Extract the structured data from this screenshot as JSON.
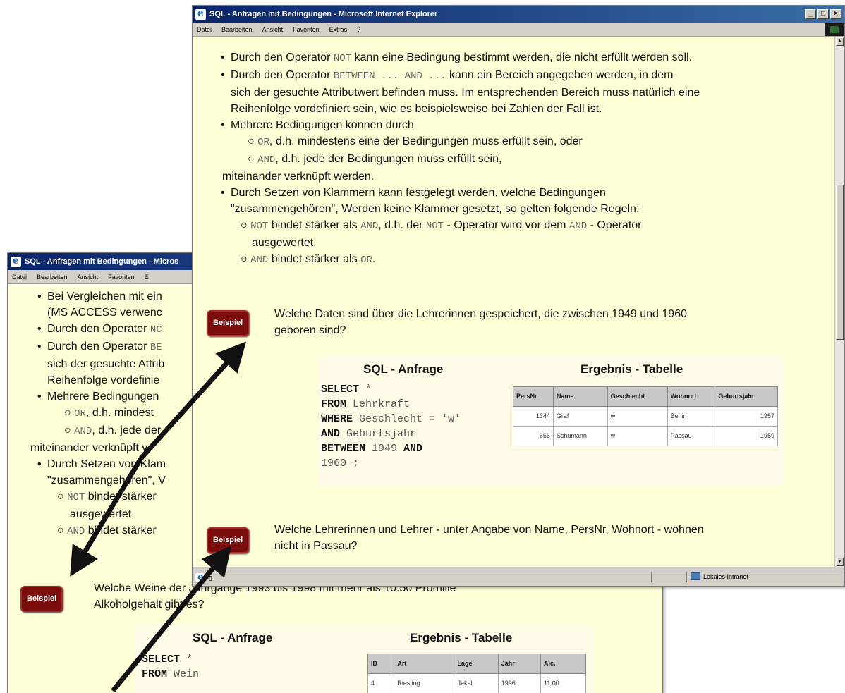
{
  "back_window": {
    "title": "SQL - Anfragen mit Bedingungen - Micros",
    "menu": [
      "Datei",
      "Bearbeiten",
      "Ansicht",
      "Favoriten",
      "E"
    ],
    "bullets": [
      {
        "text": "Bei Vergleichen mit ein",
        "cont": "(MS ACCESS verwenc"
      },
      {
        "pre": "Durch den Operator ",
        "mono": "NC"
      },
      {
        "pre": "Durch den Operator ",
        "mono": "BE",
        "cont1": "sich der gesuchte Attrib",
        "cont2": "Reihenfolge vordefinie"
      },
      {
        "text": "Mehrere Bedingungen"
      }
    ],
    "sub_or": {
      "mono": "OR",
      "text": ", d.h. mindest"
    },
    "sub_and": {
      "mono": "AND",
      "text": ", d.h. jede der"
    },
    "connect": "miteinander verknüpft v",
    "bracket": {
      "text": "Durch Setzen von Klam",
      "cont": "\"zusammengehören\", V"
    },
    "sub_not": {
      "mono": "NOT",
      "text": " bindet stärker",
      "cont": "ausgewertet."
    },
    "sub_and2": {
      "mono": "AND",
      "text": " bindet stärker"
    },
    "beispiel": "Beispiel",
    "question_l1": "Welche Weine der Jahrgänge 1993 bis 1998 mit mehr als 10.50 Promille",
    "question_l2": "Alkoholgehalt gibt es?",
    "sql_heading": "SQL - Anfrage",
    "result_heading": "Ergebnis - Tabelle",
    "sql_lines": [
      {
        "kw": "SELECT",
        "rest": " *"
      },
      {
        "kw": "FROM",
        "rest": " Wein"
      }
    ],
    "table": {
      "headers": [
        "ID",
        "Art",
        "Lage",
        "Jahr",
        "Alc."
      ],
      "rows": [
        [
          "4",
          "Riesling",
          "Jekel",
          "1996",
          "11.00"
        ]
      ]
    }
  },
  "front_window": {
    "title": "SQL - Anfragen mit Bedingungen - Microsoft Internet Explorer",
    "menu": [
      "Datei",
      "Bearbeiten",
      "Ansicht",
      "Favoriten",
      "Extras",
      "?"
    ],
    "not_bullet": {
      "pre": "Durch den Operator ",
      "mono": "NOT",
      "post": " kann eine Bedingung bestimmt werden, die nicht erfüllt werden soll."
    },
    "between_bullet": {
      "pre": "Durch den Operator ",
      "mono1": "BETWEEN ... AND ...",
      "post": " kann ein Bereich angegeben werden, in dem",
      "l2": "sich der gesuchte Attributwert befinden muss. Im entsprechenden Bereich muss natürlich eine",
      "l3": "Reihenfolge vordefiniert sein, wie es beispielsweise bei Zahlen der Fall ist."
    },
    "multi_bullet": "Mehrere Bedingungen können durch",
    "sub_or": {
      "mono": "OR",
      "text": ", d.h. mindestens eine der Bedingungen muss erfüllt sein, oder"
    },
    "sub_and": {
      "mono": "AND",
      "text": ", d.h. jede der Bedingungen muss erfüllt sein,"
    },
    "connect": "miteinander verknüpft werden.",
    "bracket_bullet": {
      "l1": "Durch Setzen von Klammern kann festgelegt werden, welche Bedingungen",
      "l2": "\"zusammengehören\", Werden keine Klammer gesetzt, so gelten folgende Regeln:"
    },
    "sub_not": {
      "mono": "NOT",
      "text1": " bindet stärker als ",
      "mono2": "AND",
      "text2": ",  d.h. der ",
      "mono3": "NOT",
      "text3": " - Operator wird vor dem ",
      "mono4": "AND",
      "text4": " - Operator",
      "cont": "ausgewertet."
    },
    "sub_and2": {
      "mono": "AND",
      "text": " bindet stärker als ",
      "mono2": "OR",
      "text2": "."
    },
    "beispiel1": "Beispiel",
    "q1_l1": "Welche Daten sind über die Lehrerinnen gespeichert, die zwischen 1949 und 1960",
    "q1_l2": "geboren sind?",
    "sql_heading": "SQL - Anfrage",
    "result_heading": "Ergebnis - Tabelle",
    "sql_lines": [
      {
        "kw": "SELECT",
        "rest": " *"
      },
      {
        "kw": "FROM",
        "rest": " Lehrkraft"
      },
      {
        "kw": "WHERE",
        "rest": " Geschlecht = 'w'"
      },
      {
        "kw": "AND",
        "rest": " Geburtsjahr"
      },
      {
        "kw": "BETWEEN",
        "rest": " 1949 ",
        "kw2": "AND"
      },
      {
        "kw": "",
        "rest": "1960 ;"
      }
    ],
    "table": {
      "headers": [
        "PersNr",
        "Name",
        "Geschlecht",
        "Wohnort",
        "Geburtsjahr"
      ],
      "rows": [
        [
          "1344",
          "Graf",
          "w",
          "Berlin",
          "1957"
        ],
        [
          "666",
          "Schumann",
          "w",
          "Passau",
          "1959"
        ]
      ]
    },
    "beispiel2": "Beispiel",
    "q2_l1": "Welche Lehrerinnen und Lehrer - unter Angabe von Name, PersNr, Wohnort - wohnen",
    "q2_l2": "nicht in Passau?",
    "status_left": "ig",
    "status_zone": "Lokales Intranet"
  },
  "colors": {
    "content_bg": "#ffffd8",
    "titlebar": "#0a246a",
    "beispiel": "#7a0c0c"
  }
}
